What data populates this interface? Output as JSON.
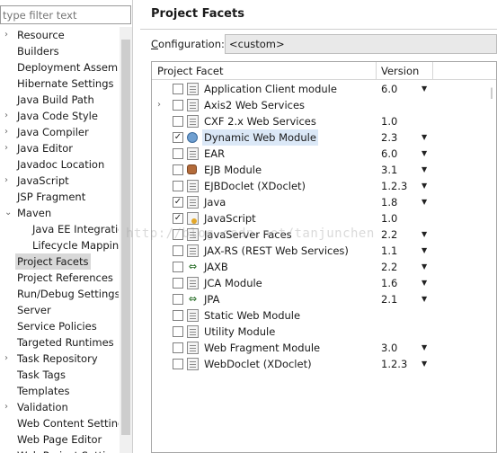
{
  "filter": {
    "placeholder": "type filter text"
  },
  "nav": [
    {
      "label": "Resource",
      "toggle": "›",
      "child": false
    },
    {
      "label": "Builders",
      "toggle": "",
      "child": false
    },
    {
      "label": "Deployment Assembly",
      "toggle": "",
      "child": false
    },
    {
      "label": "Hibernate Settings",
      "toggle": "",
      "child": false
    },
    {
      "label": "Java Build Path",
      "toggle": "",
      "child": false
    },
    {
      "label": "Java Code Style",
      "toggle": "›",
      "child": false
    },
    {
      "label": "Java Compiler",
      "toggle": "›",
      "child": false
    },
    {
      "label": "Java Editor",
      "toggle": "›",
      "child": false
    },
    {
      "label": "Javadoc Location",
      "toggle": "",
      "child": false
    },
    {
      "label": "JavaScript",
      "toggle": "›",
      "child": false
    },
    {
      "label": "JSP Fragment",
      "toggle": "",
      "child": false
    },
    {
      "label": "Maven",
      "toggle": "⌄",
      "child": false
    },
    {
      "label": "Java EE Integration",
      "toggle": "",
      "child": true
    },
    {
      "label": "Lifecycle Mapping",
      "toggle": "",
      "child": true
    },
    {
      "label": "Project Facets",
      "toggle": "",
      "child": false,
      "selected": true
    },
    {
      "label": "Project References",
      "toggle": "",
      "child": false
    },
    {
      "label": "Run/Debug Settings",
      "toggle": "",
      "child": false
    },
    {
      "label": "Server",
      "toggle": "",
      "child": false
    },
    {
      "label": "Service Policies",
      "toggle": "",
      "child": false
    },
    {
      "label": "Targeted Runtimes",
      "toggle": "",
      "child": false
    },
    {
      "label": "Task Repository",
      "toggle": "›",
      "child": false
    },
    {
      "label": "Task Tags",
      "toggle": "",
      "child": false
    },
    {
      "label": "Templates",
      "toggle": "",
      "child": false
    },
    {
      "label": "Validation",
      "toggle": "›",
      "child": false
    },
    {
      "label": "Web Content Settings",
      "toggle": "",
      "child": false
    },
    {
      "label": "Web Page Editor",
      "toggle": "",
      "child": false
    },
    {
      "label": "Web Project Settings",
      "toggle": "",
      "child": false
    }
  ],
  "page": {
    "title": "Project Facets",
    "config_label_prefix": "C",
    "config_label_rest": "onfiguration:",
    "config_value": "<custom>"
  },
  "table": {
    "col_facet": "Project Facet",
    "col_version": "Version",
    "rows": [
      {
        "name": "Application Client module",
        "version": "6.0",
        "checked": false,
        "icon": "doc-icon",
        "dropdown": true,
        "expand": ""
      },
      {
        "name": "Axis2 Web Services",
        "version": "",
        "checked": false,
        "icon": "doc-icon",
        "dropdown": false,
        "expand": "›"
      },
      {
        "name": "CXF 2.x Web Services",
        "version": "1.0",
        "checked": false,
        "icon": "doc-icon",
        "dropdown": false,
        "expand": ""
      },
      {
        "name": "Dynamic Web Module",
        "version": "2.3",
        "checked": true,
        "icon": "globe-icon",
        "dropdown": true,
        "expand": "",
        "selected": true
      },
      {
        "name": "EAR",
        "version": "6.0",
        "checked": false,
        "icon": "doc-icon",
        "dropdown": true,
        "expand": ""
      },
      {
        "name": "EJB Module",
        "version": "3.1",
        "checked": false,
        "icon": "bean-icon",
        "dropdown": true,
        "expand": ""
      },
      {
        "name": "EJBDoclet (XDoclet)",
        "version": "1.2.3",
        "checked": false,
        "icon": "doc-icon",
        "dropdown": true,
        "expand": ""
      },
      {
        "name": "Java",
        "version": "1.8",
        "checked": true,
        "icon": "doc-icon",
        "dropdown": true,
        "expand": ""
      },
      {
        "name": "JavaScript",
        "version": "1.0",
        "checked": true,
        "icon": "warn-icon",
        "dropdown": false,
        "expand": ""
      },
      {
        "name": "JavaServer Faces",
        "version": "2.2",
        "checked": false,
        "icon": "doc-icon",
        "dropdown": true,
        "expand": ""
      },
      {
        "name": "JAX-RS (REST Web Services)",
        "version": "1.1",
        "checked": false,
        "icon": "doc-icon",
        "dropdown": true,
        "expand": ""
      },
      {
        "name": "JAXB",
        "version": "2.2",
        "checked": false,
        "icon": "arrow-icon",
        "dropdown": true,
        "expand": ""
      },
      {
        "name": "JCA Module",
        "version": "1.6",
        "checked": false,
        "icon": "doc-icon",
        "dropdown": true,
        "expand": ""
      },
      {
        "name": "JPA",
        "version": "2.1",
        "checked": false,
        "icon": "arrow-icon",
        "dropdown": true,
        "expand": ""
      },
      {
        "name": "Static Web Module",
        "version": "",
        "checked": false,
        "icon": "doc-icon",
        "dropdown": false,
        "expand": ""
      },
      {
        "name": "Utility Module",
        "version": "",
        "checked": false,
        "icon": "doc-icon",
        "dropdown": false,
        "expand": ""
      },
      {
        "name": "Web Fragment Module",
        "version": "3.0",
        "checked": false,
        "icon": "doc-icon",
        "dropdown": true,
        "expand": ""
      },
      {
        "name": "WebDoclet (XDoclet)",
        "version": "1.2.3",
        "checked": false,
        "icon": "doc-icon",
        "dropdown": true,
        "expand": ""
      }
    ]
  },
  "watermark": "http://blog.csdn.net/tanjunchen"
}
